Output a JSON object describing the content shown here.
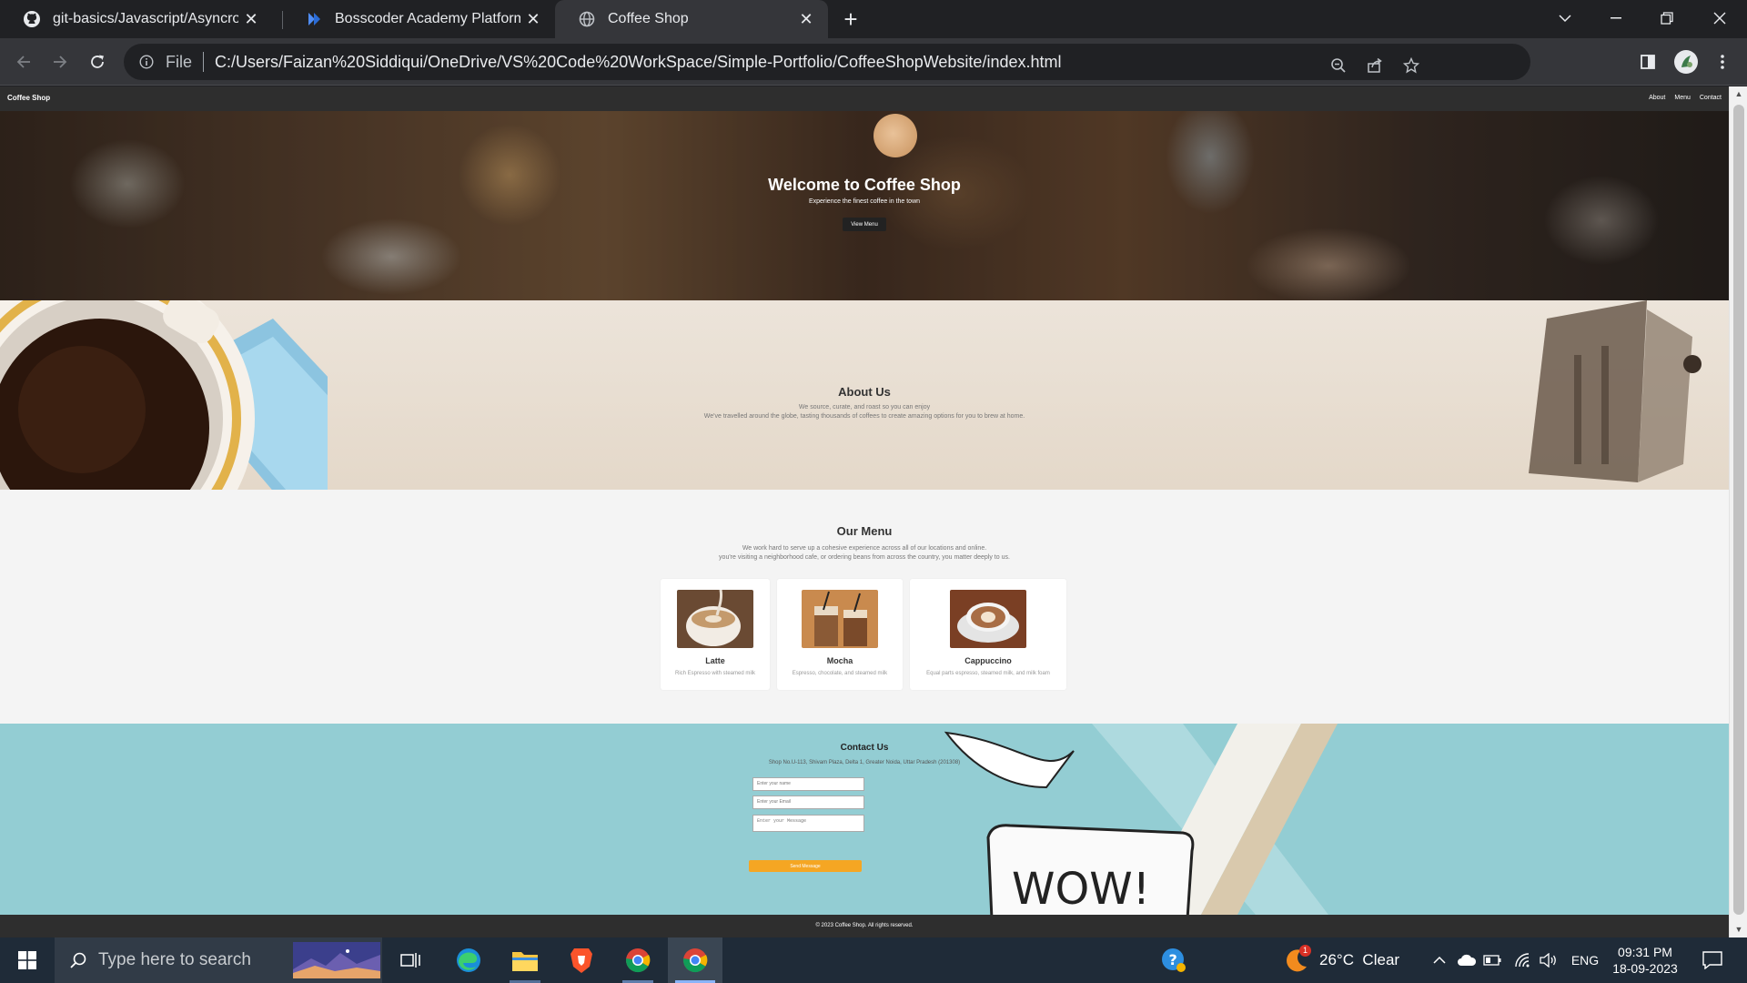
{
  "browser": {
    "tabs": [
      {
        "title": "git-basics/Javascript/Asyncronou",
        "icon": "github-icon"
      },
      {
        "title": "Bosscoder Academy Platform",
        "icon": "bosscoder-icon"
      },
      {
        "title": "Coffee Shop",
        "icon": "globe-icon",
        "active": true
      }
    ],
    "omnibox": {
      "scheme_label": "File",
      "url": "C:/Users/Faizan%20Siddiqui/OneDrive/VS%20Code%20WorkSpace/Simple-Portfolio/CoffeeShopWebsite/index.html"
    }
  },
  "site": {
    "nav": {
      "brand": "Coffee Shop",
      "links": [
        "About",
        "Menu",
        "Contact"
      ]
    },
    "hero": {
      "title": "Welcome to Coffee Shop",
      "subtitle": "Experience the finest coffee in the town",
      "button": "View Menu"
    },
    "about": {
      "title": "About Us",
      "line1": "We source, curate, and roast so you can enjoy",
      "line2": "We've travelled around the globe, tasting thousands of coffees to create amazing options for you to brew at home."
    },
    "menu": {
      "title": "Our Menu",
      "line1": "We work hard to serve up a cohesive experience across all of our locations and online.",
      "line2": "you're visiting a neighborhood cafe, or ordering beans from across the country, you matter deeply to us.",
      "items": [
        {
          "name": "Latte",
          "desc": "Rich Espresso with steamed milk"
        },
        {
          "name": "Mocha",
          "desc": "Espresso, chocolate, and steamed milk"
        },
        {
          "name": "Cappuccino",
          "desc": "Equal parts espresso, steamed milk, and milk foam"
        }
      ]
    },
    "contact": {
      "title": "Contact Us",
      "address": "Shop No.U-113, Shivam Plaza, Delta 1, Greater Noida, Uttar Pradesh (201308)",
      "name_placeholder": "Enter your name",
      "email_placeholder": "Enter your Email",
      "message_placeholder": "Enter your Message",
      "send": "Send Message",
      "deco_text": "WOW!"
    },
    "footer": "© 2023 Coffee Shop. All rights reserved."
  },
  "taskbar": {
    "search_placeholder": "Type here to search",
    "weather": "26°C  Clear",
    "weather_badge": "1",
    "language": "ENG",
    "time": "09:31 PM",
    "date": "18-09-2023"
  },
  "colors": {
    "accent": "#f5a623",
    "chrome_dark": "#202124",
    "contact_bg": "#93cdd3"
  }
}
